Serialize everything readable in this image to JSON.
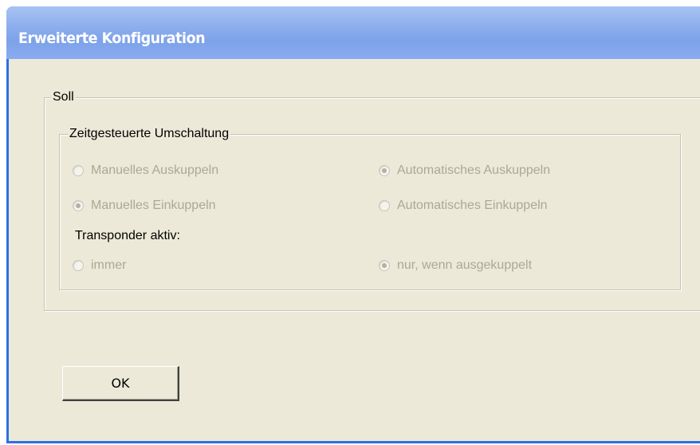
{
  "window": {
    "title": "Erweiterte Konfiguration"
  },
  "soll_group": {
    "label": "Soll"
  },
  "zeit_group": {
    "label": "Zeitgesteuerte Umschaltung",
    "radios": [
      {
        "label": "Manuelles Auskuppeln",
        "checked": false,
        "enabled": false
      },
      {
        "label": "Automatisches Auskuppeln",
        "checked": true,
        "enabled": false
      },
      {
        "label": "Manuelles Einkuppeln",
        "checked": true,
        "enabled": false
      },
      {
        "label": "Automatisches Einkuppeln",
        "checked": false,
        "enabled": false
      }
    ],
    "transponder_label": "Transponder aktiv:",
    "transponder_radios": [
      {
        "label": "immer",
        "checked": false,
        "enabled": false
      },
      {
        "label": "nur, wenn ausgekuppelt",
        "checked": true,
        "enabled": false
      }
    ]
  },
  "buttons": {
    "ok_label": "OK"
  },
  "colors": {
    "window_bg": "#ece9d8",
    "title_bar": "#8fb0ee",
    "border_accent": "#2f6fe6",
    "disabled_text": "#aca899"
  }
}
